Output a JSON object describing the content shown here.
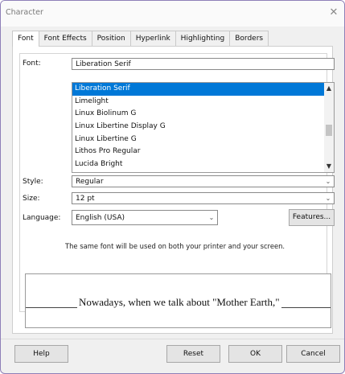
{
  "window": {
    "title": "Character",
    "close_glyph": "✕"
  },
  "tabs": [
    {
      "label": "Font",
      "active": true
    },
    {
      "label": "Font Effects"
    },
    {
      "label": "Position"
    },
    {
      "label": "Hyperlink"
    },
    {
      "label": "Highlighting"
    },
    {
      "label": "Borders"
    }
  ],
  "font": {
    "label": "Font:",
    "value": "Liberation Serif",
    "list": [
      "Liberation Serif",
      "Limelight",
      "Linux Biolinum G",
      "Linux Libertine Display G",
      "Linux Libertine G",
      "Lithos Pro Regular",
      "Lucida Bright"
    ],
    "selected_index": 0
  },
  "style": {
    "label": "Style:",
    "value": "Regular"
  },
  "size": {
    "label": "Size:",
    "value": "12 pt"
  },
  "language": {
    "label": "Language:",
    "value": "English (USA)",
    "features_button": "Features..."
  },
  "note": "The same font will be used on both your printer and your screen.",
  "preview": {
    "text": "Nowadays, when we talk about \"Mother Earth,\""
  },
  "buttons": {
    "help": "Help",
    "reset": "Reset",
    "ok": "OK",
    "cancel": "Cancel"
  },
  "colors": {
    "selection": "#0078d7",
    "border_accent": "#8e7fb8"
  },
  "icons": {
    "scroll_up": "▲",
    "scroll_down": "▼",
    "dropdown": "⌄"
  }
}
